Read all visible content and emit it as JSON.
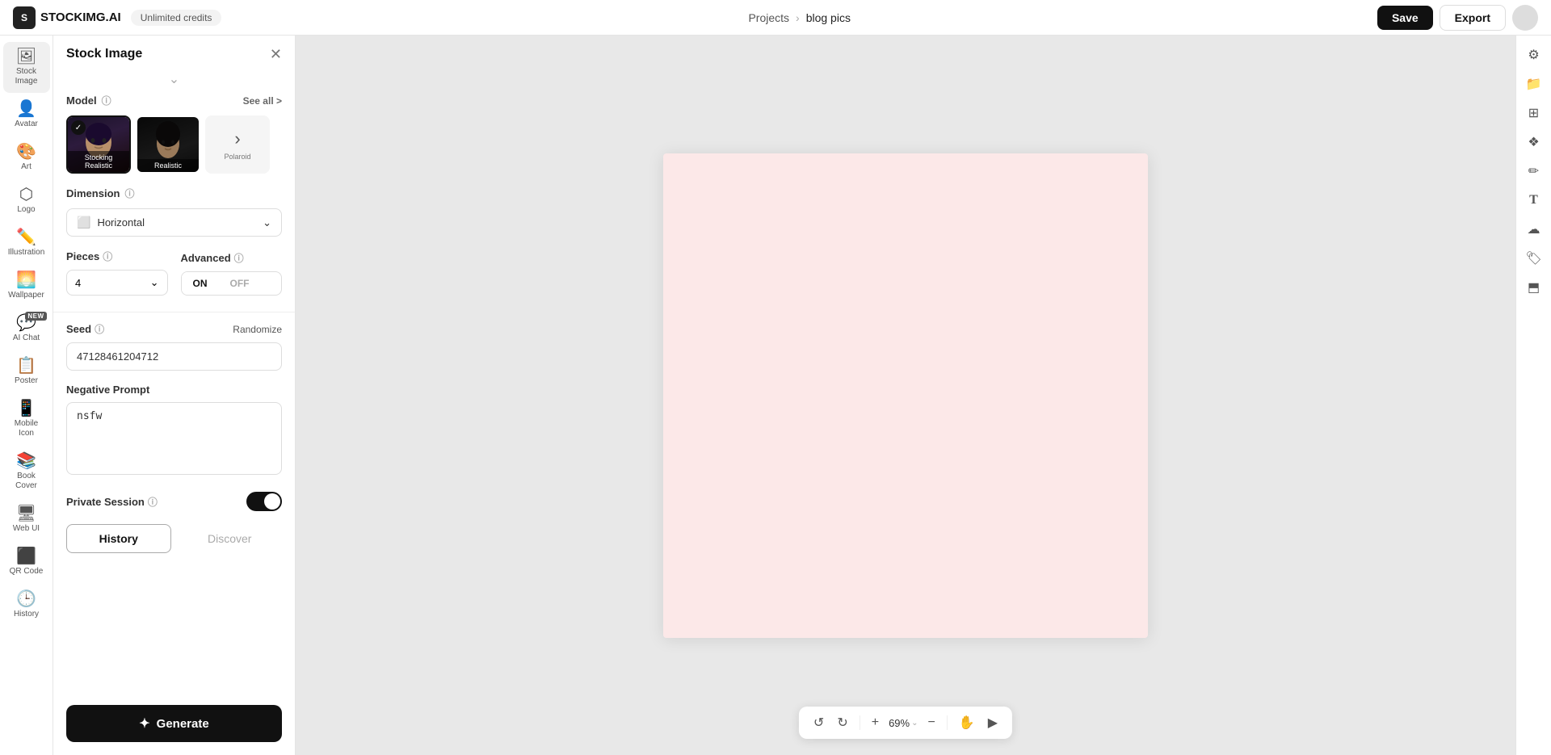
{
  "topbar": {
    "logo_text": "STOCKIMG.AI",
    "logo_abbr": "S",
    "credits_label": "Unlimited credits",
    "project_parent": "Projects",
    "project_name": "blog pics",
    "save_label": "Save",
    "export_label": "Export"
  },
  "sidebar": {
    "items": [
      {
        "id": "stock-image",
        "label": "Stock Image",
        "icon": "🖼",
        "active": true,
        "new": false
      },
      {
        "id": "avatar",
        "label": "Avatar",
        "icon": "👤",
        "active": false,
        "new": false
      },
      {
        "id": "art",
        "label": "Art",
        "icon": "🎨",
        "active": false,
        "new": false
      },
      {
        "id": "logo",
        "label": "Logo",
        "icon": "⬡",
        "active": false,
        "new": false
      },
      {
        "id": "illustration",
        "label": "Illustration",
        "icon": "✏️",
        "active": false,
        "new": false
      },
      {
        "id": "wallpaper",
        "label": "Wallpaper",
        "icon": "🌅",
        "active": false,
        "new": false
      },
      {
        "id": "ai-chat",
        "label": "AI Chat",
        "icon": "💬",
        "active": false,
        "new": true
      },
      {
        "id": "poster",
        "label": "Poster",
        "icon": "📋",
        "active": false,
        "new": false
      },
      {
        "id": "mobile-icon",
        "label": "Mobile Icon",
        "icon": "📱",
        "active": false,
        "new": false
      },
      {
        "id": "book-cover",
        "label": "Book Cover",
        "icon": "📚",
        "active": false,
        "new": false
      },
      {
        "id": "web-ui",
        "label": "Web UI",
        "icon": "🖥",
        "active": false,
        "new": false
      },
      {
        "id": "qr-code",
        "label": "QR Code",
        "icon": "⬛",
        "active": false,
        "new": false
      },
      {
        "id": "history-sidebar",
        "label": "History",
        "icon": "🕒",
        "active": false,
        "new": false
      }
    ]
  },
  "panel": {
    "title": "Stock Image",
    "model_section_label": "Model",
    "see_all_label": "See all >",
    "models": [
      {
        "id": "stocking-realistic",
        "label": "Stocking Realistic",
        "selected": true
      },
      {
        "id": "realistic",
        "label": "Realistic",
        "selected": false
      },
      {
        "id": "polaroid",
        "label": "Polaroid",
        "selected": false
      }
    ],
    "dimension_label": "Dimension",
    "dimension_value": "Horizontal",
    "pieces_label": "Pieces",
    "pieces_value": "4",
    "advanced_label": "Advanced",
    "advanced_on": "ON",
    "advanced_off": "OFF",
    "advanced_active": "ON",
    "seed_label": "Seed",
    "randomize_label": "Randomize",
    "seed_value": "47128461204712",
    "negative_prompt_label": "Negative Prompt",
    "negative_prompt_value": "nsfw",
    "private_session_label": "Private Session",
    "history_tab": "History",
    "discover_tab": "Discover",
    "generate_label": "Generate"
  },
  "canvas": {
    "zoom_value": "69%"
  },
  "right_sidebar": {
    "icons": [
      {
        "id": "settings",
        "icon": "⚙️"
      },
      {
        "id": "folder",
        "icon": "📁"
      },
      {
        "id": "layout",
        "icon": "⊞"
      },
      {
        "id": "component",
        "icon": "❖"
      },
      {
        "id": "pencil",
        "icon": "✏"
      },
      {
        "id": "text",
        "icon": "T"
      },
      {
        "id": "cloud",
        "icon": "☁"
      },
      {
        "id": "tag",
        "icon": "🏷"
      },
      {
        "id": "layers",
        "icon": "⬒"
      }
    ]
  }
}
